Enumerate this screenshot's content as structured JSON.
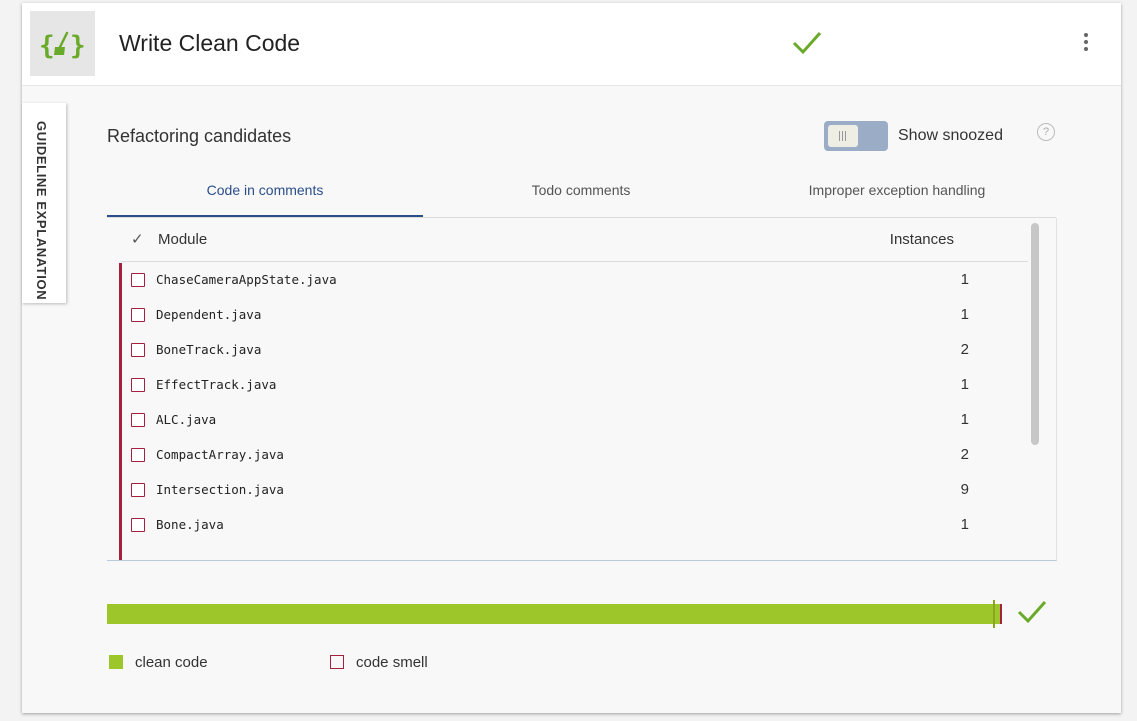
{
  "header": {
    "title": "Write Clean Code",
    "logo_icon": "braces-broom-icon",
    "status_icon": "check-icon",
    "accent_color": "#6aaa2a",
    "menu_icon": "vertical-dots-icon"
  },
  "side_tab": {
    "label": "GUIDELINE EXPLANATION"
  },
  "section": {
    "title": "Refactoring candidates"
  },
  "snooze_toggle": {
    "label": "Show snoozed",
    "state": "off",
    "help_icon": "question-circle-icon"
  },
  "tabs": [
    {
      "label": "Code in comments",
      "active": true
    },
    {
      "label": "Todo comments",
      "active": false
    },
    {
      "label": "Improper exception handling",
      "active": false
    }
  ],
  "table": {
    "columns": {
      "module": "Module",
      "instances": "Instances"
    },
    "rows": [
      {
        "module": "ChaseCameraAppState.java",
        "instances": "1"
      },
      {
        "module": "Dependent.java",
        "instances": "1"
      },
      {
        "module": "BoneTrack.java",
        "instances": "2"
      },
      {
        "module": "EffectTrack.java",
        "instances": "1"
      },
      {
        "module": "ALC.java",
        "instances": "1"
      },
      {
        "module": "CompactArray.java",
        "instances": "2"
      },
      {
        "module": "Intersection.java",
        "instances": "9"
      },
      {
        "module": "Bone.java",
        "instances": "1"
      }
    ]
  },
  "progress": {
    "clean_fraction": 0.99,
    "clean_color": "#9dc62a",
    "smell_color": "#a3203f"
  },
  "legend": {
    "clean": "clean code",
    "smell": "code smell"
  }
}
